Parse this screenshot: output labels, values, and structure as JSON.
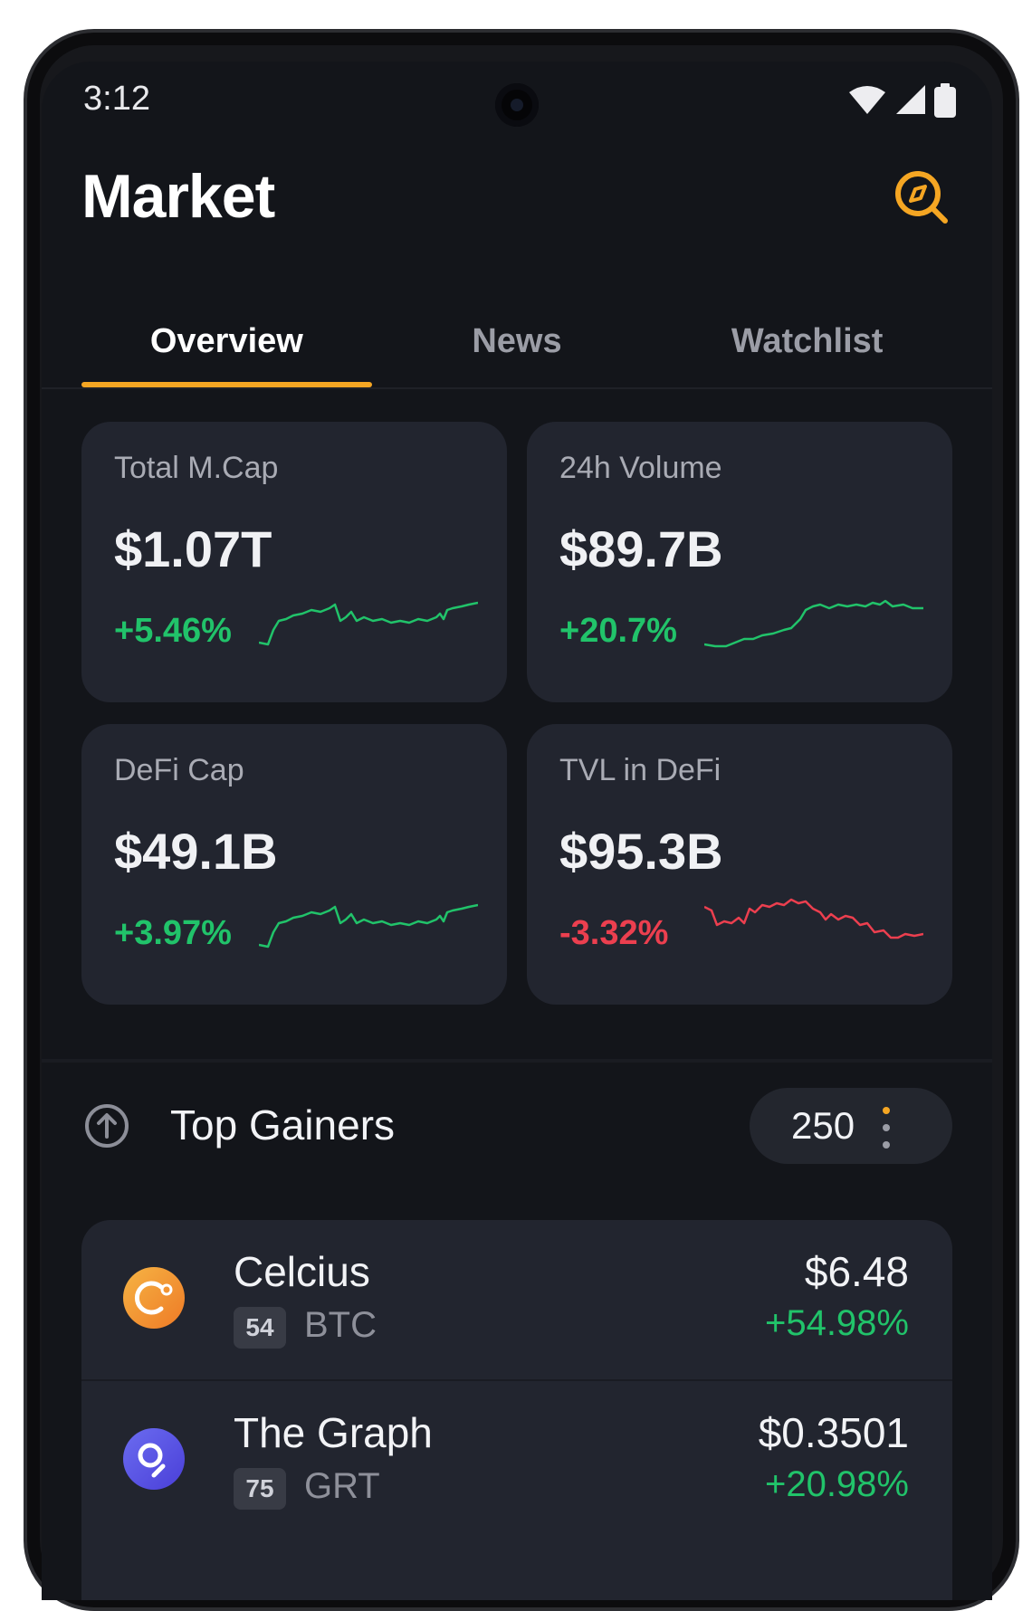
{
  "status_bar": {
    "time": "3:12"
  },
  "header": {
    "title": "Market",
    "action_icon": "discover-search-icon"
  },
  "tabs": [
    {
      "label": "Overview",
      "active": true
    },
    {
      "label": "News",
      "active": false
    },
    {
      "label": "Watchlist",
      "active": false
    }
  ],
  "stats": [
    {
      "label": "Total M.Cap",
      "value": "$1.07T",
      "change": "+5.46%",
      "trend": "up"
    },
    {
      "label": "24h Volume",
      "value": "$89.7B",
      "change": "+20.7%",
      "trend": "up"
    },
    {
      "label": "DeFi Cap",
      "value": "$49.1B",
      "change": "+3.97%",
      "trend": "up"
    },
    {
      "label": "TVL in DeFi",
      "value": "$95.3B",
      "change": "-3.32%",
      "trend": "down"
    }
  ],
  "top_gainers": {
    "title": "Top Gainers",
    "count": "250"
  },
  "coins": [
    {
      "name": "Celcius",
      "rank": "54",
      "symbol": "BTC",
      "price": "$6.48",
      "change": "+54.98%"
    },
    {
      "name": "The Graph",
      "rank": "75",
      "symbol": "GRT",
      "price": "$0.3501",
      "change": "+20.98%"
    }
  ],
  "colors": {
    "accent": "#f5a623",
    "positive": "#21c36a",
    "negative": "#ec3f4f",
    "card": "#22252f",
    "background": "#13151a"
  }
}
